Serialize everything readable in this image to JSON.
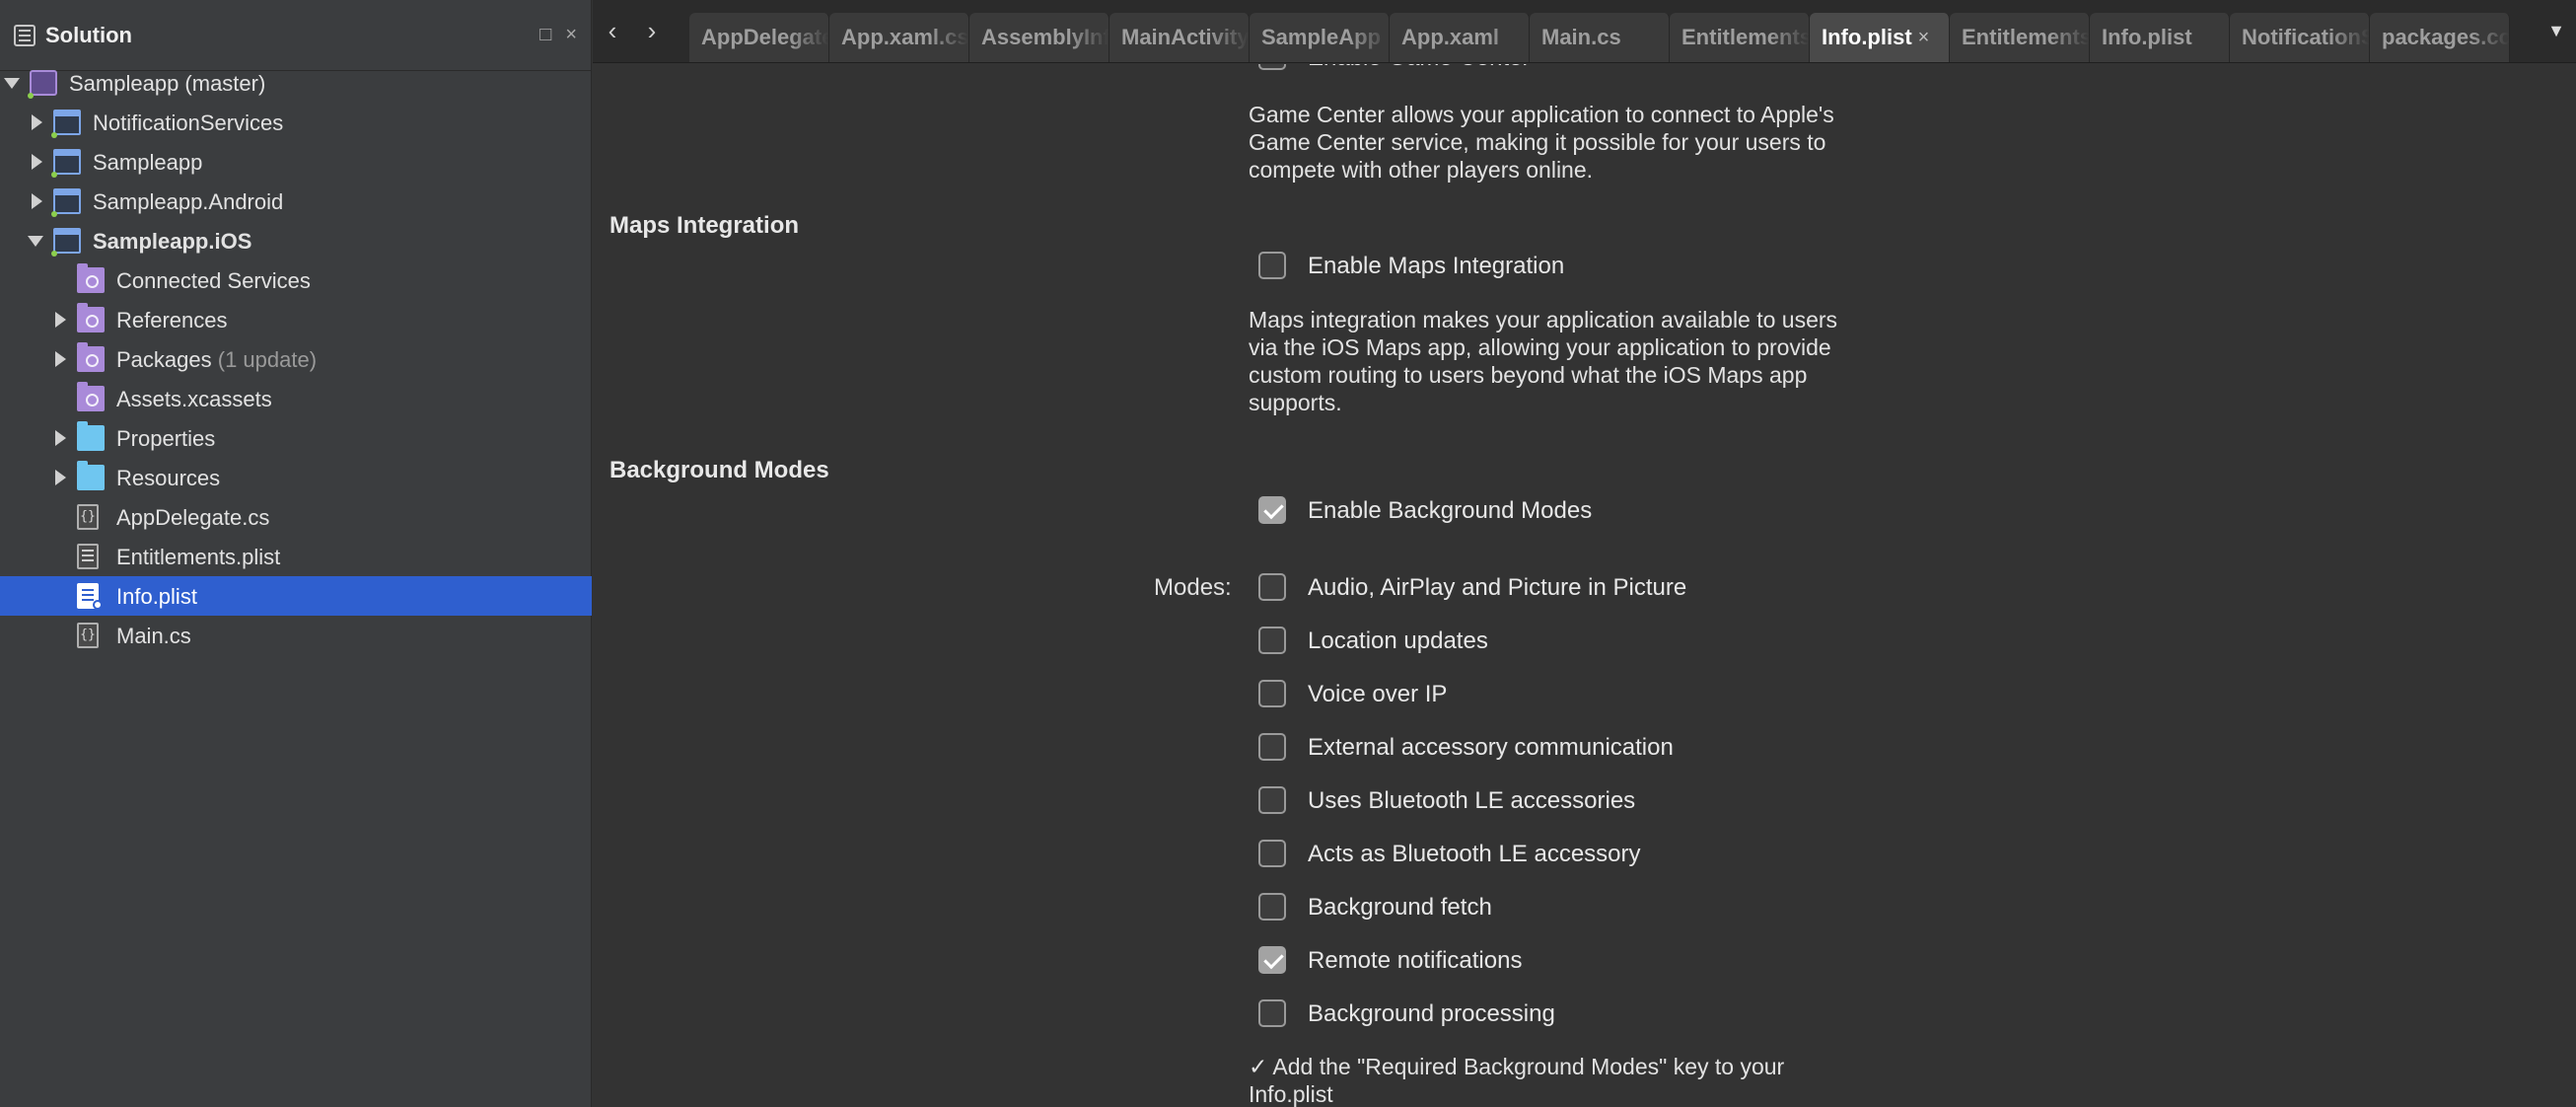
{
  "sidebar": {
    "title": "Solution",
    "buttons": {
      "maximize": "□",
      "close": "×"
    },
    "tree": [
      {
        "label": "Sampleapp (master)",
        "muted": "",
        "icon": "solution-icon",
        "level": 0,
        "expand": "down"
      },
      {
        "label": "NotificationServices",
        "muted": "",
        "icon": "project-icon",
        "level": 1,
        "expand": "right"
      },
      {
        "label": "Sampleapp",
        "muted": "",
        "icon": "project-icon",
        "level": 1,
        "expand": "right"
      },
      {
        "label": "Sampleapp.Android",
        "muted": "",
        "icon": "project-icon",
        "level": 1,
        "expand": "right"
      },
      {
        "label": "Sampleapp.iOS",
        "muted": "",
        "icon": "project-icon",
        "level": 1,
        "expand": "down",
        "bold": true
      },
      {
        "label": "Connected Services",
        "muted": "",
        "icon": "connected-services-folder-icon",
        "level": 2,
        "expand": ""
      },
      {
        "label": "References",
        "muted": "",
        "icon": "references-folder-icon",
        "level": 2,
        "expand": "right"
      },
      {
        "label": "Packages",
        "muted": "(1 update)",
        "icon": "packages-folder-icon",
        "level": 2,
        "expand": "right"
      },
      {
        "label": "Assets.xcassets",
        "muted": "",
        "icon": "assets-folder-icon",
        "level": 2,
        "expand": ""
      },
      {
        "label": "Properties",
        "muted": "",
        "icon": "folder-icon",
        "level": 2,
        "expand": "right"
      },
      {
        "label": "Resources",
        "muted": "",
        "icon": "folder-icon",
        "level": 2,
        "expand": "right"
      },
      {
        "label": "AppDelegate.cs",
        "muted": "",
        "icon": "csharp-file-icon",
        "level": 2,
        "expand": ""
      },
      {
        "label": "Entitlements.plist",
        "muted": "",
        "icon": "plist-file-icon",
        "level": 2,
        "expand": ""
      },
      {
        "label": "Info.plist",
        "muted": "",
        "icon": "plist-file-icon",
        "level": 2,
        "expand": "",
        "selected": true
      },
      {
        "label": "Main.cs",
        "muted": "",
        "icon": "csharp-file-icon",
        "level": 2,
        "expand": ""
      }
    ]
  },
  "tabbar": {
    "back": "‹",
    "forward": "›",
    "overflow": "▼",
    "tabs": [
      {
        "label": "AppDelegate.cs",
        "active": false
      },
      {
        "label": "App.xaml.cs",
        "active": false
      },
      {
        "label": "AssemblyInfo.cs",
        "active": false
      },
      {
        "label": "MainActivity.cs",
        "active": false
      },
      {
        "label": "SampleApp",
        "active": false
      },
      {
        "label": "App.xaml",
        "active": false
      },
      {
        "label": "Main.cs",
        "active": false
      },
      {
        "label": "Entitlements.plist",
        "active": false
      },
      {
        "label": "Info.plist",
        "active": true,
        "close": "×"
      },
      {
        "label": "Entitlements.plist",
        "active": false
      },
      {
        "label": "Info.plist",
        "active": false
      },
      {
        "label": "NotificationServices",
        "active": false
      },
      {
        "label": "packages.config",
        "active": false
      }
    ]
  },
  "content": {
    "game_center": {
      "checkbox_label": "Enable Game Center",
      "description_lines": [
        "Game Center allows your application to connect to Apple's",
        "Game Center service, making it possible for your users to",
        "compete with other players online."
      ]
    },
    "maps": {
      "title": "Maps Integration",
      "checkbox_label": "Enable Maps Integration",
      "checked": false,
      "description_lines": [
        "Maps integration makes your application available to users",
        "via the iOS Maps app, allowing your application to provide",
        "custom routing to users beyond what the iOS Maps app",
        "supports."
      ]
    },
    "background": {
      "title": "Background Modes",
      "enable_label": "Enable Background Modes",
      "enable_checked": true,
      "modes_label": "Modes:",
      "modes": [
        {
          "label": "Audio, AirPlay and Picture in Picture",
          "checked": false
        },
        {
          "label": "Location updates",
          "checked": false
        },
        {
          "label": "Voice over IP",
          "checked": false
        },
        {
          "label": "External accessory communication",
          "checked": false
        },
        {
          "label": "Uses Bluetooth LE accessories",
          "checked": false
        },
        {
          "label": "Acts as Bluetooth LE accessory",
          "checked": false
        },
        {
          "label": "Background fetch",
          "checked": false
        },
        {
          "label": "Remote notifications",
          "checked": true
        },
        {
          "label": "Background processing",
          "checked": false
        }
      ],
      "note_lines": [
        "✓ Add the \"Required Background Modes\" key to your",
        "Info.plist"
      ]
    }
  },
  "colors": {
    "selection": "#2f5fcf",
    "sidebar_bg": "#3b3d3f",
    "content_bg": "#333333",
    "tabbar_bg": "#2b2b2b"
  }
}
